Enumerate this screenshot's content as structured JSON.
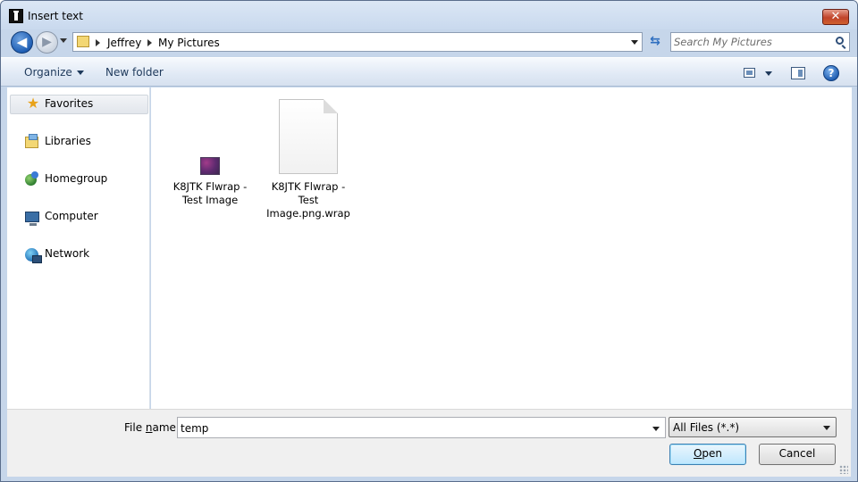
{
  "window": {
    "title": "Insert text",
    "close_glyph": "✕"
  },
  "nav": {
    "back_glyph": "◀",
    "forward_glyph": "▶"
  },
  "address": {
    "crumbs": [
      "Jeffrey",
      "My Pictures"
    ]
  },
  "search": {
    "placeholder": "Search My Pictures"
  },
  "toolbar": {
    "organize_label": "Organize",
    "new_folder_label": "New folder",
    "help_glyph": "?"
  },
  "sidebar": {
    "items": [
      {
        "label": "Favorites",
        "icon": "star-icon",
        "selected": true
      },
      {
        "label": "Libraries",
        "icon": "libraries-icon"
      },
      {
        "label": "Homegroup",
        "icon": "homegroup-icon"
      },
      {
        "label": "Computer",
        "icon": "computer-icon"
      },
      {
        "label": "Network",
        "icon": "network-icon"
      }
    ]
  },
  "files": [
    {
      "line1": "K8JTK Flwrap -",
      "line2": "Test Image",
      "line3": "",
      "icon": "image-thumbnail"
    },
    {
      "line1": "K8JTK Flwrap -",
      "line2": "Test",
      "line3": "Image.png.wrap",
      "icon": "document-icon"
    }
  ],
  "bottom": {
    "file_name_label_pre": "File ",
    "file_name_label_key": "n",
    "file_name_label_post": "ame:",
    "file_name_value": "temp",
    "filter_value": "All Files (*.*)",
    "open_key": "O",
    "open_rest": "pen",
    "cancel_label": "Cancel"
  },
  "colors": {
    "frame": "#c6d6ea",
    "accent": "#1f5fb5",
    "close": "#c0432a"
  }
}
